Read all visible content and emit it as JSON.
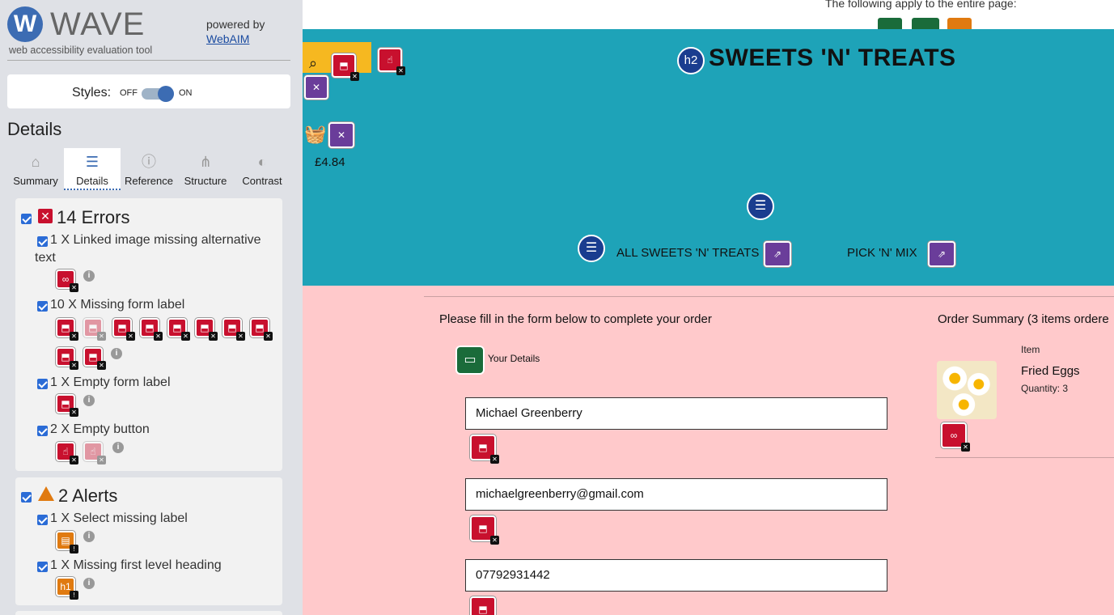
{
  "wave": {
    "logo_letter": "W",
    "logo_word": "WAVE",
    "tagline": "web accessibility evaluation tool",
    "powered_by": "powered by",
    "webaim_link": "WebAIM",
    "styles_label": "Styles:",
    "styles_off": "OFF",
    "styles_on": "ON",
    "details_heading": "Details",
    "tabs": [
      {
        "label": "Summary",
        "icon": "home-icon"
      },
      {
        "label": "Details",
        "icon": "list-icon"
      },
      {
        "label": "Reference",
        "icon": "info-icon"
      },
      {
        "label": "Structure",
        "icon": "hierarchy-icon"
      },
      {
        "label": "Contrast",
        "icon": "contrast-icon"
      }
    ],
    "errors": {
      "title": "14 Errors",
      "items": [
        {
          "text": "1 X Linked image missing alternative text"
        },
        {
          "text": "10 X Missing form label"
        },
        {
          "text": "1 X Empty form label"
        },
        {
          "text": "2 X Empty button"
        }
      ]
    },
    "alerts": {
      "title": "2 Alerts",
      "items": [
        {
          "text": "1 X Select missing label",
          "icon_label": ""
        },
        {
          "text": "1 X Missing first level heading",
          "icon_label": "h1"
        }
      ]
    }
  },
  "page": {
    "apply_text": "The following apply to the entire page:",
    "site_title": "SWEETS 'N' TREATS",
    "h2_badge": "h2",
    "basket_total": "£4.84",
    "nav": [
      "ALL SWEETS 'N' TREATS",
      "PICK 'N' MIX"
    ],
    "form_intro": "Please fill in the form below to complete your order",
    "your_details": "Your Details",
    "fields": [
      "Michael Greenberry",
      "michaelgreenberry@gmail.com",
      "07792931442"
    ],
    "order_summary": "Order Summary (3 items ordere",
    "item_col": "Item",
    "item_name": "Fried Eggs",
    "item_qty": "Quantity: 3"
  },
  "colors": {
    "error": "#c8102e",
    "alert": "#e07a10",
    "hero": "#1ea3b8",
    "form_bg": "#ffc9cb",
    "wave_blue": "#3c6cb3"
  }
}
